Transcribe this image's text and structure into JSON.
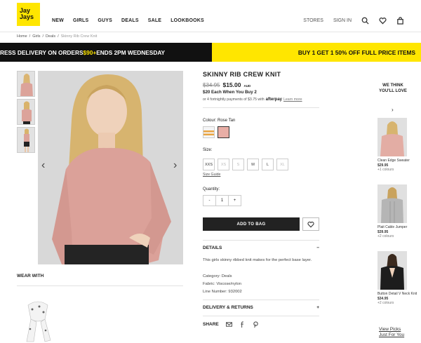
{
  "brand": {
    "logo_line1": "Jay",
    "logo_line2": "Jays"
  },
  "nav": [
    "NEW",
    "GIRLS",
    "GUYS",
    "DEALS",
    "SALE",
    "LOOKBOOKS"
  ],
  "util": {
    "stores": "STORES",
    "signin": "SIGN IN"
  },
  "breadcrumb": {
    "home": "Home",
    "sep": "/",
    "girls": "Girls",
    "deals": "Deals",
    "current": "Skinny Rib Crew Knit"
  },
  "promo": {
    "left_pre": "RESS DELIVERY ON ORDERS ",
    "left_hl": "$90+",
    "left_post": " ENDS 2PM WEDNESDAY",
    "right_pre": "BUY 1 GET 1 ",
    "right_hl": "50% OFF",
    "right_post": " FULL PRICE ITEMS"
  },
  "product": {
    "title": "SKINNY RIB CREW KNIT",
    "old_price": "$34.95",
    "price": "$15.00",
    "currency": "AUD",
    "promo": "$20 Each When You Buy 2",
    "afterpay_text": "or 4 fortnightly payments of $3.75 with",
    "afterpay_brand": "afterpay",
    "learn_more": "Learn more",
    "colour_label": "Colour:",
    "colour_value": "Rose Tan",
    "size_label": "Size:",
    "sizes": [
      "XXS",
      "XS",
      "S",
      "M",
      "L",
      "XL"
    ],
    "size_guide": "Size Guide",
    "quantity_label": "Quantity:",
    "qty_minus": "-",
    "qty_value": "1",
    "qty_plus": "+",
    "add_to_bag": "ADD TO BAG",
    "details_label": "DETAILS",
    "details_toggle": "−",
    "description": "This girls skinny ribbed knit makes for the perfect base layer.",
    "category": "Category:  Deals",
    "fabric": "Fabric:  Viscose/nylon",
    "line_number": "Line Number:  932002",
    "delivery_label": "DELIVERY & RETURNS",
    "delivery_toggle": "+",
    "share_label": "SHARE"
  },
  "wear_with": "WEAR WITH",
  "rail": {
    "title": "WE THINK YOU'LL LOVE",
    "chevron": "›",
    "items": [
      {
        "name": "Clean Edge Sweater",
        "price": "$29.95",
        "colours": "+1 colours"
      },
      {
        "name": "Plait Cable Jumper",
        "price": "$39.95",
        "colours": "+2 colours"
      },
      {
        "name": "Button Detail V Neck Knit",
        "price": "$34.95",
        "colours": "+2 colours"
      }
    ],
    "view_picks": "View Picks",
    "just_for_you": "Just For You"
  },
  "colors": {
    "accent": "#ffe600",
    "dark": "#111111",
    "swatch_rose": "#e8aea6"
  }
}
